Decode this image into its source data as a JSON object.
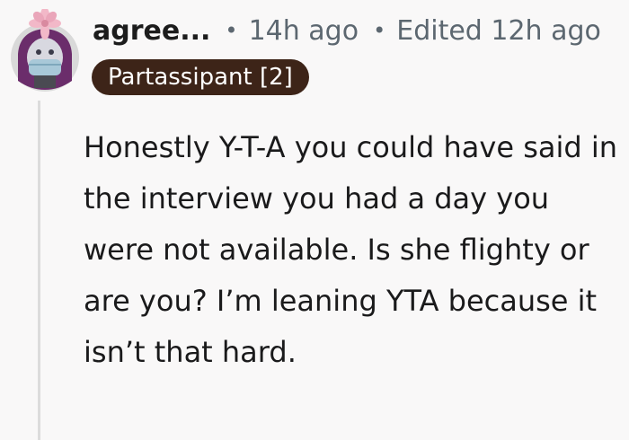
{
  "comment": {
    "username": "agree...",
    "posted_time": "14h ago",
    "edited_time": "Edited 12h ago",
    "separator": "•",
    "flair": "Partassipant [2]",
    "body": "Honestly Y-T-A you could have said in the interview you had a day you were not available. Is she flighty or are you? I’m leaning YTA because it isn’t that hard."
  },
  "avatar": {
    "icon": "user-avatar-icon",
    "colors": {
      "hair": "#6b2d6b",
      "face": "#d8d8e0",
      "mask": "#a8c8d8",
      "flower": "#f2b8c8",
      "background": "#d9d9d9"
    }
  },
  "colors": {
    "background": "#f9f8f8",
    "username": "#1c1c1c",
    "meta": "#5c6770",
    "flair_bg": "#3d2418",
    "flair_text": "#ffffff",
    "body": "#1a1a1b",
    "thread_line": "#dcdcdc"
  }
}
